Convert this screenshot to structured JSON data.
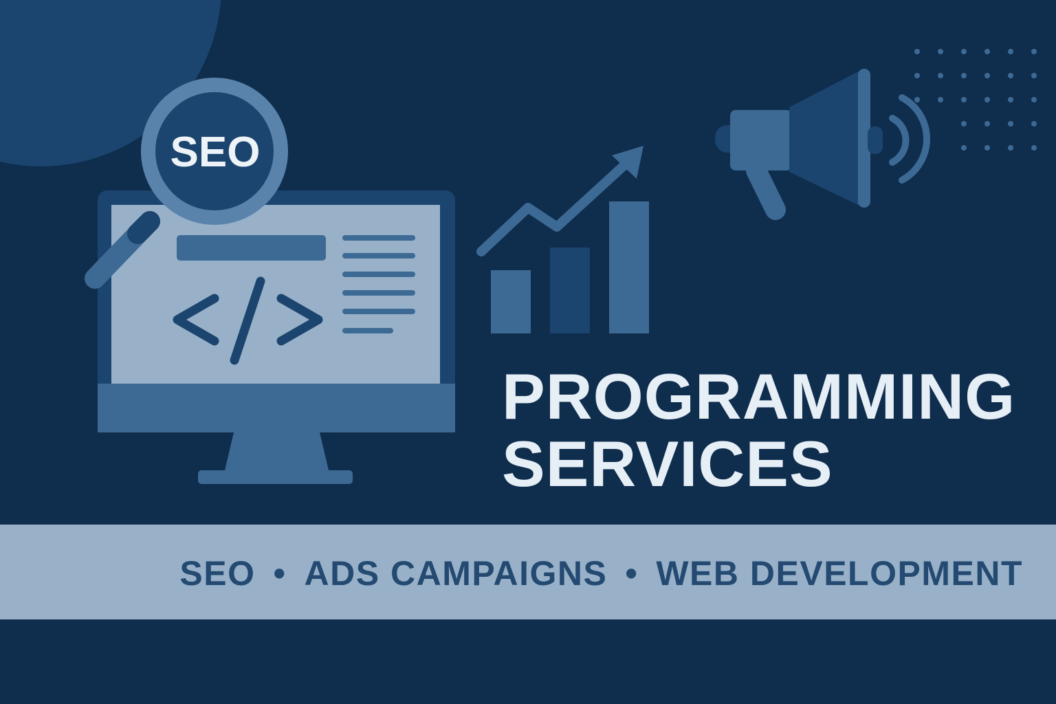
{
  "magnifier": {
    "label": "SEO"
  },
  "headline": {
    "line1": "PROGRAMMING",
    "line2": "SERVICES"
  },
  "services": [
    {
      "label": "SEO"
    },
    {
      "label": "ADS CAMPAIGNS"
    },
    {
      "label": "WEB DEVELOPMENT"
    }
  ],
  "separator": "•",
  "colors": {
    "background": "#0f2d4d",
    "accent_dark": "#1b456e",
    "accent_mid": "#3d6a94",
    "light": "#98b1c8",
    "text_light": "#e6eef6",
    "banner_text": "#244a72"
  },
  "icons": [
    "magnifier-icon",
    "monitor-icon",
    "code-icon",
    "bar-chart-icon",
    "trend-arrow-icon",
    "megaphone-icon"
  ]
}
